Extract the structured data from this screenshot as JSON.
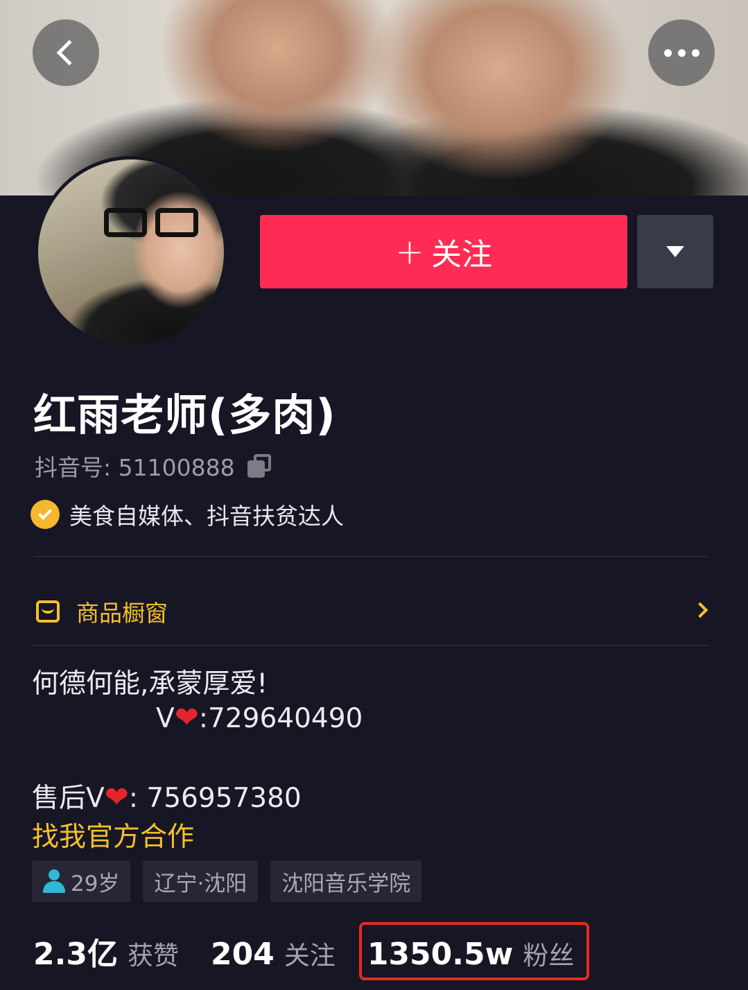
{
  "profile": {
    "name": "红雨老师(多肉)",
    "douyin_id_label": "抖音号:",
    "douyin_id": "51100888",
    "verification": "美食自媒体、抖音扶贫达人",
    "follow_label": "关注",
    "follow_plus": "+"
  },
  "shop": {
    "label": "商品橱窗"
  },
  "bio": {
    "line1": "何德何能,承蒙厚爱!",
    "line2_prefix": "V",
    "line2_heart": "❤",
    "line2_value": ":729640490",
    "line3_prefix": "售后V",
    "line3_heart": "❤",
    "line3_value": ": 756957380",
    "collab_link": "找我官方合作"
  },
  "tags": [
    {
      "icon": "person-icon",
      "label": "29岁"
    },
    {
      "label": "辽宁·沈阳"
    },
    {
      "label": "沈阳音乐学院"
    }
  ],
  "stats": [
    {
      "value": "2.3亿",
      "label": "获赞"
    },
    {
      "value": "204",
      "label": "关注"
    },
    {
      "value": "1350.5w",
      "label": "粉丝"
    }
  ],
  "colors": {
    "follow_button": "#fe2c55",
    "accent_gold": "#f5c02b",
    "background": "#161625",
    "highlight_box": "#e52b1f"
  },
  "icons": {
    "back": "chevron-left-icon",
    "more": "more-dots-icon",
    "dropdown": "triangle-down-icon",
    "copy": "copy-icon",
    "verified": "verified-check-icon",
    "shop": "shop-icon",
    "shop_arrow": "chevron-right-icon"
  }
}
